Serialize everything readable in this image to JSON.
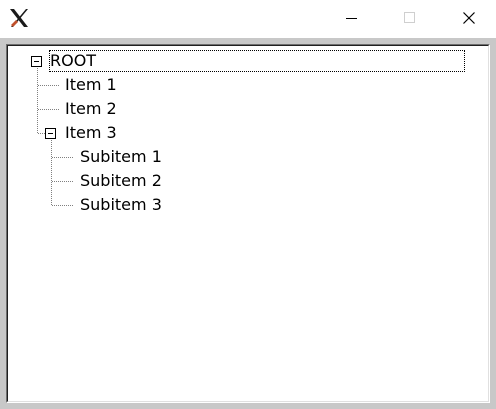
{
  "window": {
    "app_icon": "x-logo-icon",
    "controls": {
      "minimize_icon": "minimize-icon",
      "maximize_icon": "maximize-icon",
      "close_icon": "close-icon"
    }
  },
  "tree": {
    "root": {
      "label": "ROOT",
      "expanded": true,
      "selected": true
    },
    "items": [
      {
        "label": "Item 1"
      },
      {
        "label": "Item 2"
      },
      {
        "label": "Item 3",
        "expanded": true,
        "children": [
          {
            "label": "Subitem 1"
          },
          {
            "label": "Subitem 2"
          },
          {
            "label": "Subitem 3"
          }
        ]
      }
    ]
  }
}
